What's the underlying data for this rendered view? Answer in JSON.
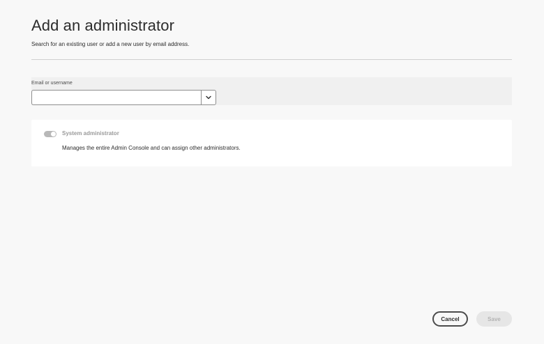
{
  "header": {
    "title": "Add an administrator",
    "subtitle": "Search for an existing user or add a new user by email address."
  },
  "form": {
    "email_label": "Email or username",
    "email_value": "",
    "email_placeholder": "",
    "dropdown_icon": "chevron-down-icon"
  },
  "role": {
    "toggle_state": "off",
    "toggle_disabled": true,
    "name": "System administrator",
    "description": "Manages the entire Admin Console and can assign other administrators."
  },
  "footer": {
    "cancel_label": "Cancel",
    "save_label": "Save"
  },
  "colors": {
    "background": "#f8f8f8",
    "card": "#ffffff",
    "disabled_text": "#9a9a9a",
    "button_border": "#4b4b4b",
    "save_disabled_bg": "#e6e6e6"
  }
}
